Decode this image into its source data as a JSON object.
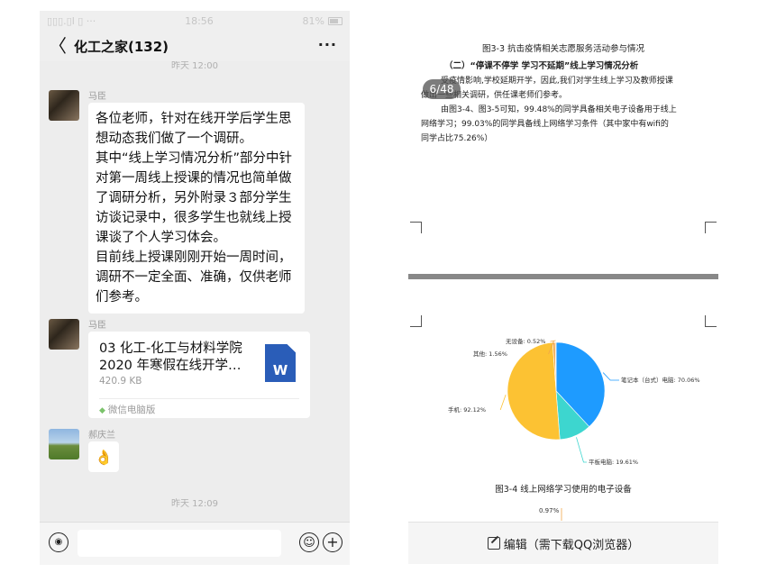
{
  "wechat": {
    "status_bar": {
      "signal": "▯▯▯.▯l ▯ ···",
      "time": "18:56",
      "battery": "81%"
    },
    "header": {
      "back": "〈",
      "title": "化工之家(132)",
      "more": "···"
    },
    "time_top": "昨天 12:00",
    "messages": [
      {
        "sender": "马臣",
        "lines": [
          "各位老师，针对在线开学后学生思",
          "想动态我们做了一个调研。",
          "其中“线上学习情况分析”部分中针",
          "对第一周线上授课的情况也简单做",
          "了调研分析，另外附录３部分学生",
          "访谈记录中，很多学生也就线上授",
          "课谈了个人学习体会。",
          "目前线上授课刚刚开始一周时间，",
          "调研不一定全面、准确，仅供老师",
          "们参考。"
        ]
      },
      {
        "sender": "马臣",
        "file_name_1": "03 化工-化工与材料学院",
        "file_name_2": "2020 年寒假在线开学…",
        "file_size": "420.9 KB",
        "file_icon": "W",
        "source": "微信电脑版"
      },
      {
        "sender": "郝庆兰",
        "emoji": "👌"
      }
    ],
    "time_bottom": "昨天 12:09",
    "input_bar": {
      "voice_icon": "voice-icon",
      "emoji_icon": "emoji-icon",
      "plus_icon": "plus-icon"
    }
  },
  "doc": {
    "caption_top": "图3-3 抗击疫情相关志愿服务活动参与情况",
    "section_title": "（二）“停课不停学 学习不延期”线上学习情况分析",
    "para1_line1": "受疫情影响,学校延期开学，因此,我们对学生线上学习及教师授课",
    "para1_line2": "做出一些相关调研，供任课老师们参考。",
    "para2_line1": "由图3-4、图3-5可知，99.48%的同学具备相关电子设备用于线上",
    "para2_line2": "网络学习；99.03%的同学具备线上网络学习条件（其中家中有wifi的",
    "para2_line3": "同学占比75.26%）",
    "page_badge": "6/48",
    "caption_chart": "图3-4 线上网络学习使用的电子设备",
    "next_fragment": "0.97%",
    "bottom_bar": "编辑（需下载QQ浏览器）"
  },
  "chart_data": {
    "type": "pie",
    "categories": [
      "笔记本（台式）电脑",
      "平板电脑",
      "手机",
      "其他",
      "无设备"
    ],
    "labels": [
      "笔记本（台式）电脑: 70.06%",
      "平板电脑: 19.61%",
      "手机: 92.12%",
      "其他: 1.56%",
      "无设备: 0.52%"
    ],
    "values": [
      70.06,
      19.61,
      92.12,
      1.56,
      0.52
    ],
    "colors": [
      "#1e9bff",
      "#3dd6cf",
      "#fcc233",
      "#f0a64b",
      "#f2a641"
    ]
  }
}
